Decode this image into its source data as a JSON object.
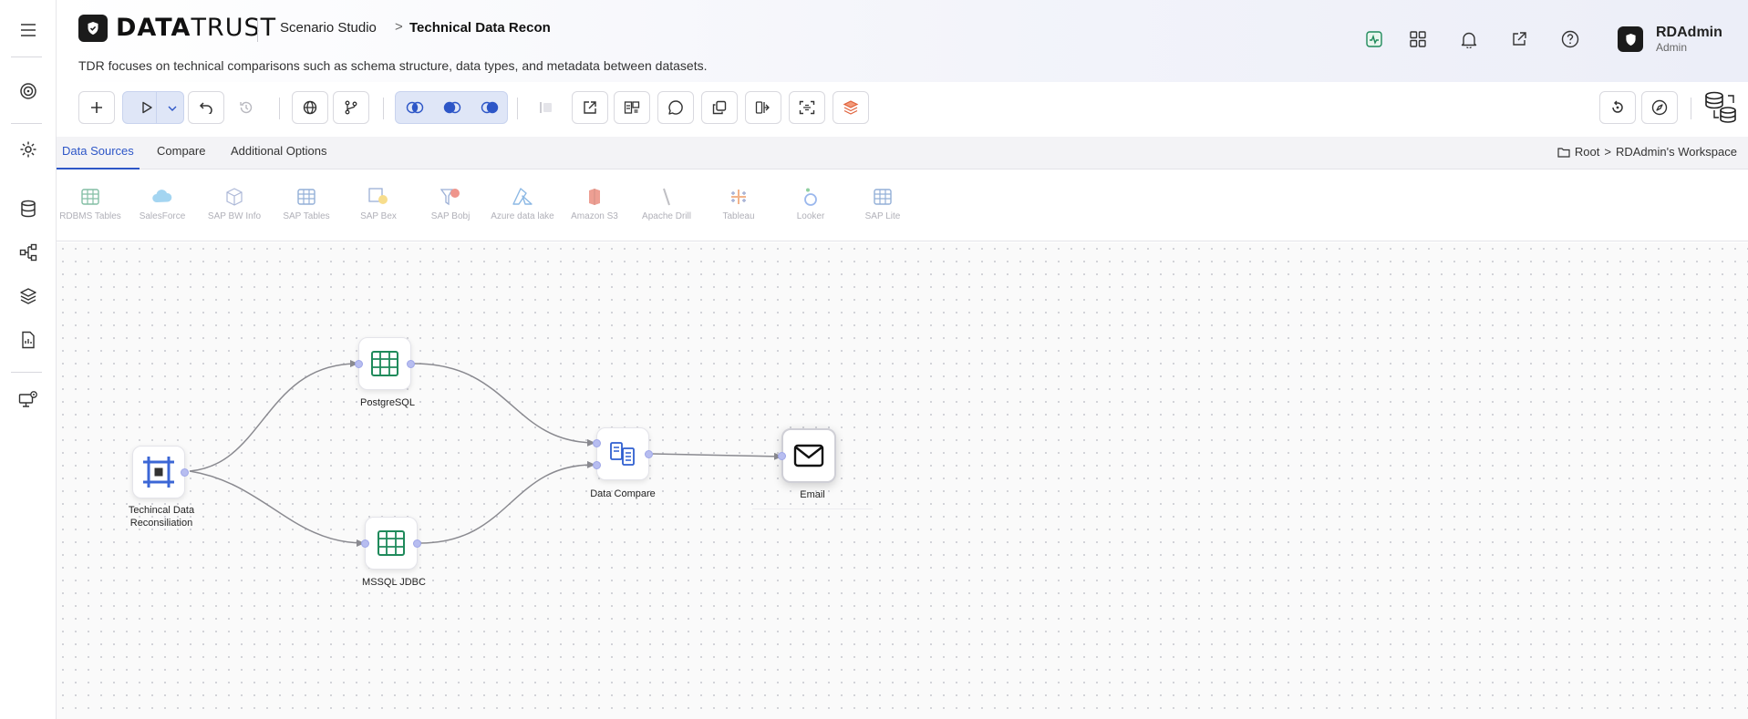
{
  "header": {
    "brand_bold": "DATA",
    "brand_light": "TRUST",
    "breadcrumb_studio": "Scenario Studio",
    "breadcrumb_sep": ">",
    "breadcrumb_page": "Technical Data Recon",
    "description": "TDR focuses on technical comparisons such as schema structure, data types, and metadata between datasets.",
    "user_name": "RDAdmin",
    "user_role": "Admin"
  },
  "tabs": [
    {
      "label": "Data Sources"
    },
    {
      "label": "Compare"
    },
    {
      "label": "Additional Options"
    }
  ],
  "workspace": {
    "root": "Root",
    "sep": ">",
    "name": "RDAdmin's Workspace"
  },
  "palette": [
    {
      "label": "RDBMS Tables",
      "icon": "table-icon"
    },
    {
      "label": "SalesForce",
      "icon": "cloud-icon"
    },
    {
      "label": "SAP BW Info",
      "icon": "cube-icon"
    },
    {
      "label": "SAP Tables",
      "icon": "table-icon"
    },
    {
      "label": "SAP Bex",
      "icon": "bex-icon"
    },
    {
      "label": "SAP Bobj",
      "icon": "bobj-icon"
    },
    {
      "label": "Azure data lake",
      "icon": "azure-icon"
    },
    {
      "label": "Amazon S3",
      "icon": "s3-icon"
    },
    {
      "label": "Apache Drill",
      "icon": "drill-icon"
    },
    {
      "label": "Tableau",
      "icon": "tableau-icon"
    },
    {
      "label": "Looker",
      "icon": "looker-icon"
    },
    {
      "label": "SAP Lite",
      "icon": "table-icon"
    }
  ],
  "nodes": {
    "start": {
      "label": "Techincal Data Reconsiliation"
    },
    "postgres": {
      "label": "PostgreSQL"
    },
    "mssql": {
      "label": "MSSQL JDBC"
    },
    "compare": {
      "label": "Data Compare"
    },
    "email": {
      "label": "Email"
    }
  },
  "colors": {
    "accent": "#2d56c7",
    "port": "#b7bdf0",
    "table_green": "#1f8a5b",
    "flow_blue": "#2f5fd0"
  }
}
